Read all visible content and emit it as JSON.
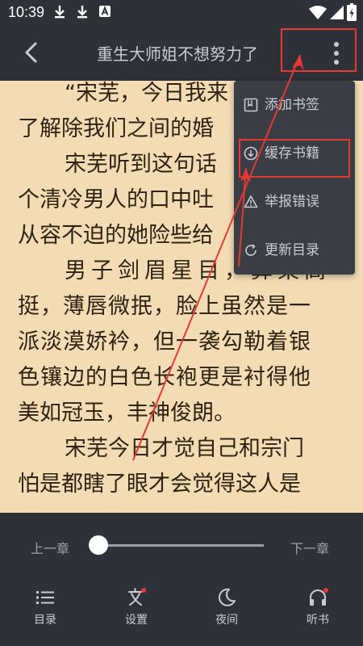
{
  "status": {
    "time": "10:39"
  },
  "header": {
    "title": "重生大师姐不想努力了"
  },
  "content": {
    "lines": [
      "“宋芜，今日我来",
      "了解除我们之间的婚",
      "宋芜听到这句话",
      "个清冷男人的口中吐",
      "从容不迫的她险些给",
      "男子剑眉星目，鼻梁高",
      "挺，薄唇微抿，脸上虽然是一",
      "派淡漠娇衿，但一袭勾勒着银",
      "色镶边的白色长袍更是衬得他",
      "美如冠玉，丰神俊朗。",
      "宋芜今日才觉自己和宗门",
      "怕是都瞎了眼才会觉得这人是"
    ]
  },
  "menu": {
    "items": [
      {
        "label": "添加书签",
        "icon": "bookmark-icon"
      },
      {
        "label": "缓存书籍",
        "icon": "download-icon"
      },
      {
        "label": "举报错误",
        "icon": "warning-icon"
      },
      {
        "label": "更新目录",
        "icon": "refresh-icon"
      }
    ]
  },
  "controls": {
    "prev_chapter": "上一章",
    "next_chapter": "下一章",
    "progress": 0
  },
  "tabs": [
    {
      "label": "目录",
      "icon": "list-icon",
      "badge": false
    },
    {
      "label": "设置",
      "icon": "text-settings-icon",
      "badge": true
    },
    {
      "label": "夜间",
      "icon": "moon-icon",
      "badge": false
    },
    {
      "label": "听书",
      "icon": "headphones-icon",
      "badge": true
    }
  ],
  "colors": {
    "bar_bg": "#2e3137",
    "paper_bg": "#f3dcb4",
    "menu_bg": "#3a3d44",
    "text_light": "#c9ced6",
    "annotation_red": "#e53935",
    "badge_red": "#e53935"
  }
}
